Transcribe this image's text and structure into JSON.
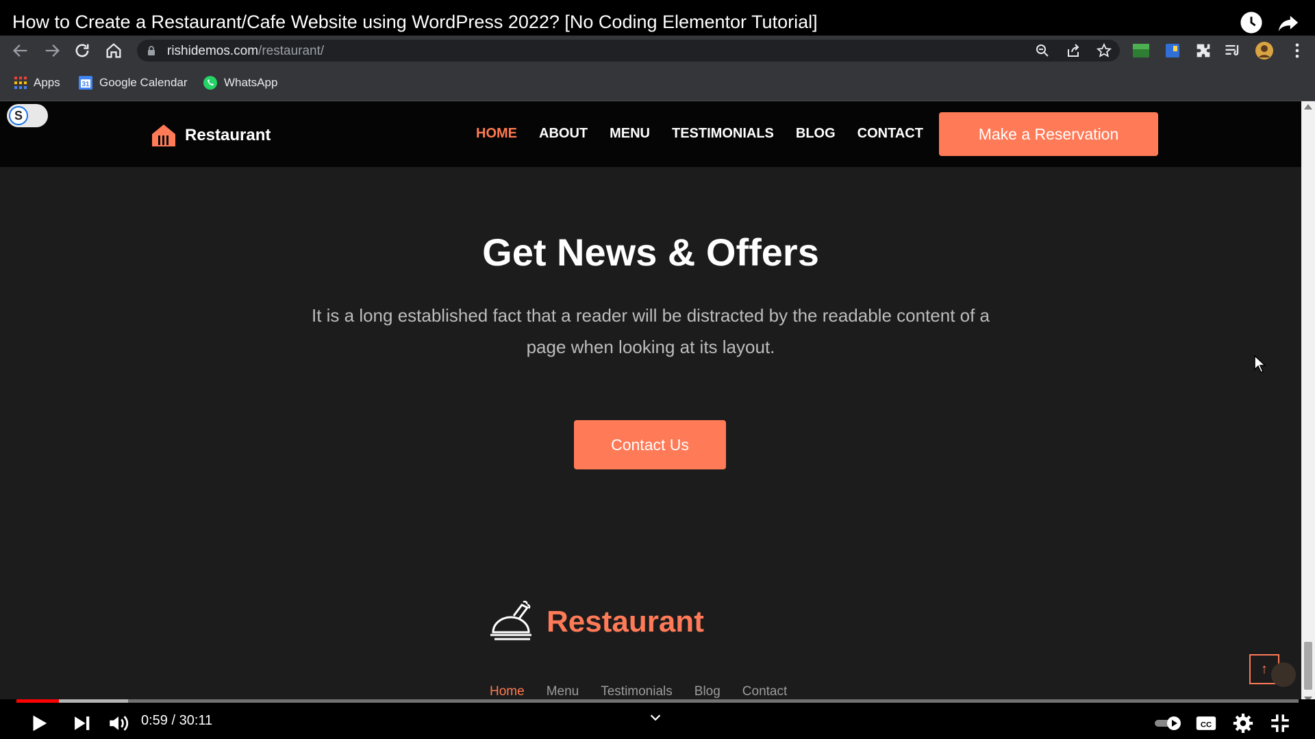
{
  "youtube": {
    "title": "How to Create a Restaurant/Cafe Website using WordPress 2022? [No Coding Elementor Tutorial]",
    "time_current": "0:59",
    "time_separator": " / ",
    "time_total": "30:11",
    "progress_played_fraction": 0.033,
    "progress_buffered_fraction": 0.087
  },
  "browser": {
    "url_domain": "rishidemos.com",
    "url_path": "/restaurant/",
    "bookmarks": [
      {
        "label": "Apps",
        "icon": "apps-grid-icon"
      },
      {
        "label": "Google Calendar",
        "icon": "google-calendar-icon"
      },
      {
        "label": "WhatsApp",
        "icon": "whatsapp-icon"
      }
    ]
  },
  "site": {
    "toggle_letter": "S",
    "logo_text": "Restaurant",
    "nav": [
      "HOME",
      "ABOUT",
      "MENU",
      "TESTIMONIALS",
      "BLOG",
      "CONTACT"
    ],
    "nav_active": "HOME",
    "reserve_label": "Make a Reservation",
    "headline": "Get News & Offers",
    "lead": "It is a long established fact that a reader will be distracted by the readable content of a page when looking at its layout.",
    "contact_label": "Contact Us",
    "footer_logo_text": "Restaurant",
    "footer_nav": [
      "Home",
      "Menu",
      "Testimonials",
      "Blog",
      "Contact"
    ],
    "to_top_glyph": "↑"
  },
  "colors": {
    "accent": "#ff7a57",
    "page_bg": "#1c1c1d",
    "header_bg": "#050505"
  }
}
